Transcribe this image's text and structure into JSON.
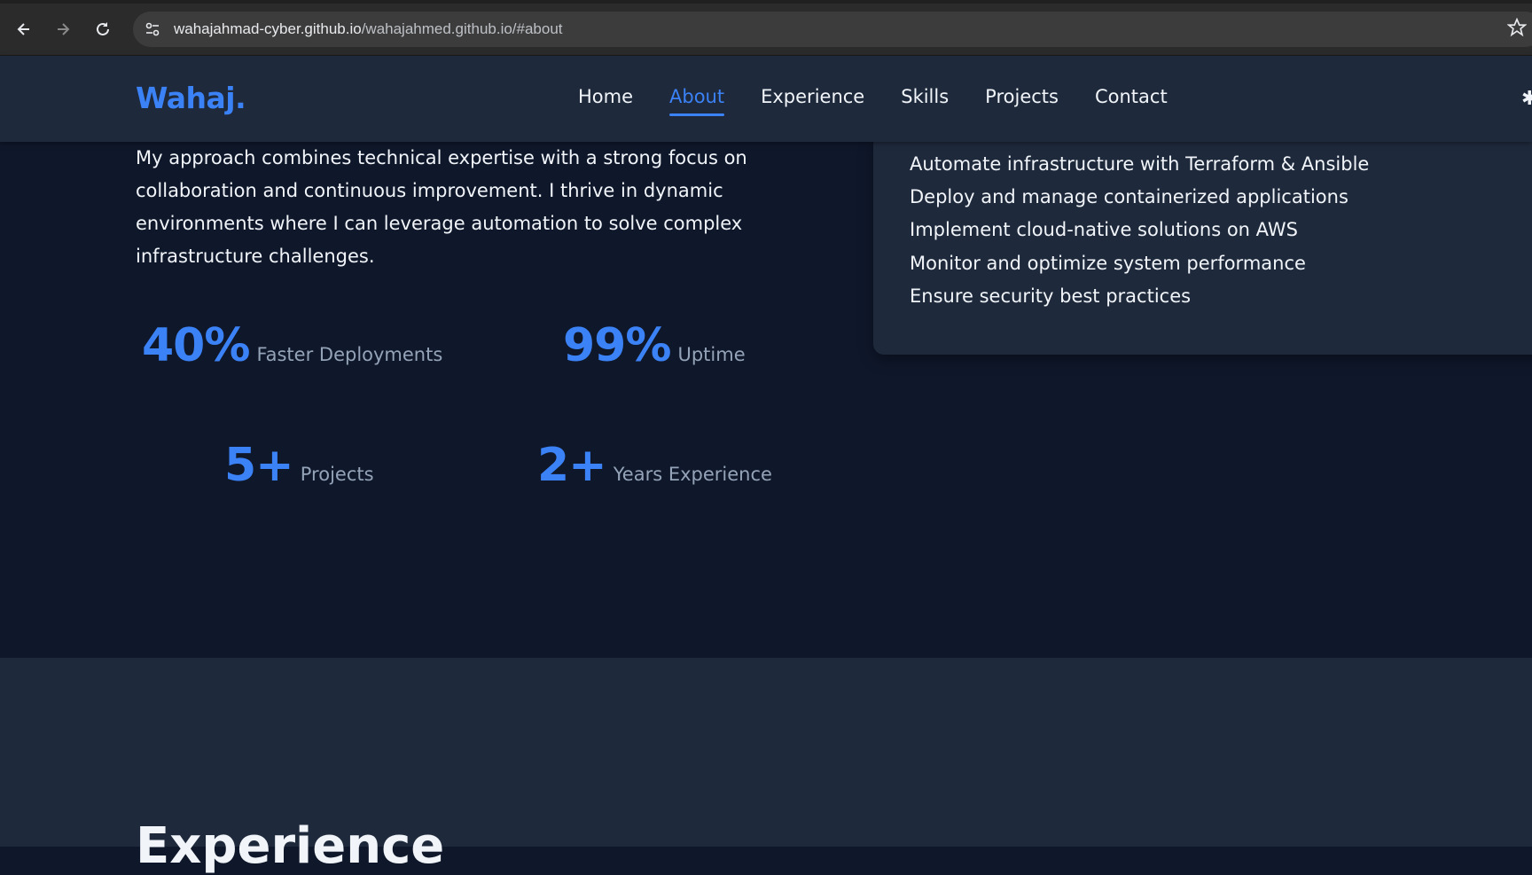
{
  "browser": {
    "url_host": "wahajahmad-cyber.github.io",
    "url_path": "/wahajahmed.github.io/#about"
  },
  "header": {
    "logo": "Wahaj.",
    "nav": [
      {
        "label": "Home",
        "active": false
      },
      {
        "label": "About",
        "active": true
      },
      {
        "label": "Experience",
        "active": false
      },
      {
        "label": "Skills",
        "active": false
      },
      {
        "label": "Projects",
        "active": false
      },
      {
        "label": "Contact",
        "active": false
      }
    ]
  },
  "about": {
    "paragraph": "My approach combines technical expertise with a strong focus on collaboration and continuous improvement. I thrive in dynamic environments where I can leverage automation to solve complex infrastructure challenges.",
    "stats": [
      {
        "value": "40%",
        "label": "Faster Deployments"
      },
      {
        "value": "99%",
        "label": "Uptime"
      },
      {
        "value": "5+",
        "label": "Projects"
      },
      {
        "value": "2+",
        "label": "Years Experience"
      }
    ],
    "responsibilities": [
      "Automate infrastructure with Terraform & Ansible",
      "Deploy and manage containerized applications",
      "Implement cloud-native solutions on AWS",
      "Monitor and optimize system performance",
      "Ensure security best practices"
    ]
  },
  "experience": {
    "title": "Experience"
  },
  "colors": {
    "accent": "#3b82f6",
    "bg_dark": "#0f172a",
    "bg_panel": "#1e293b",
    "muted_text": "#94a3b8"
  }
}
